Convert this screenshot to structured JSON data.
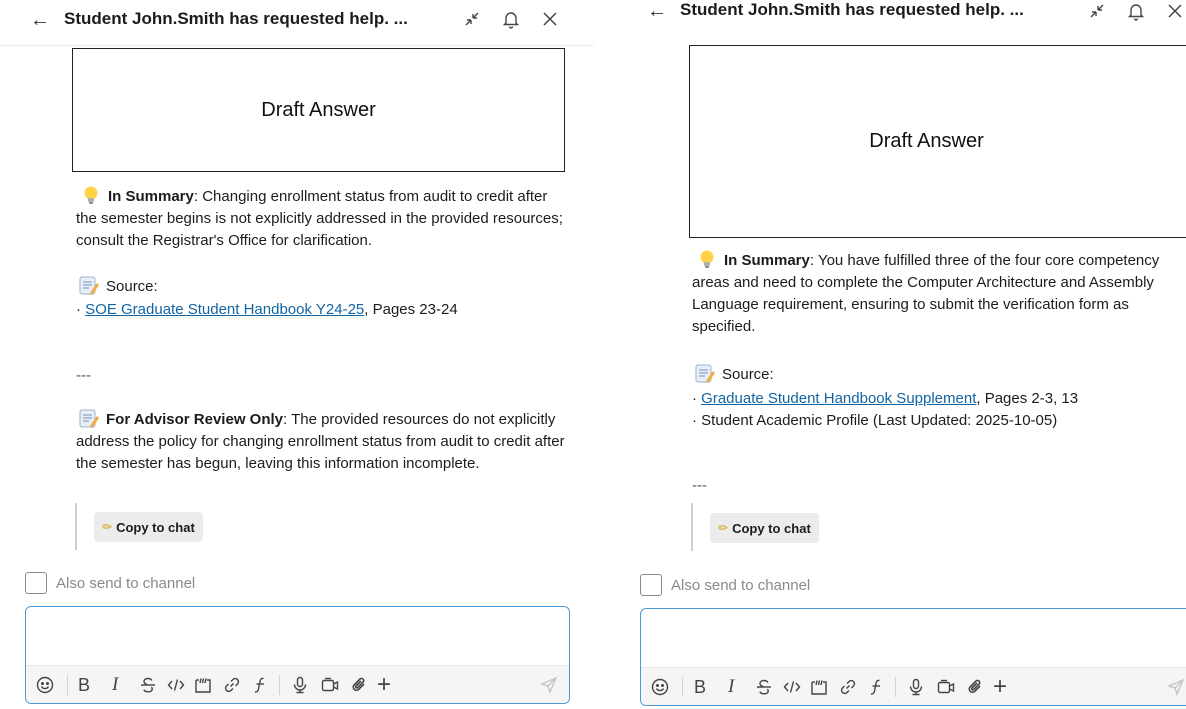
{
  "left_panel": {
    "header": {
      "title": "Student John.Smith has requested help. ..."
    },
    "draft_label": "Draft Answer",
    "summary": {
      "label": "In Summary",
      "text": ": Changing enrollment status from audit to credit after the semester begins is not explicitly addressed in the provided resources; consult the Registrar's Office for clarification."
    },
    "source": {
      "label": "Source:",
      "items": [
        {
          "link": "SOE Graduate Student Handbook Y24-25",
          "text": ", Pages 23-24"
        }
      ]
    },
    "separator": "---",
    "advisor": {
      "label": "For Advisor Review Only",
      "text": ": The provided resources do not explicitly address the policy for changing enrollment status from audit to credit after the semester has begun, leaving this information incomplete."
    },
    "copy_button": "Copy to chat",
    "also_send": "Also send to channel"
  },
  "right_panel": {
    "header": {
      "title": "Student John.Smith has requested help. ..."
    },
    "draft_label": "Draft Answer",
    "summary": {
      "label": "In Summary",
      "text": ": You have fulfilled three of the four core competency areas and need to complete the Computer Architecture and Assembly Language requirement, ensuring to submit the verification form as specified."
    },
    "source": {
      "label": "Source:",
      "items": [
        {
          "link": "Graduate Student Handbook Supplement",
          "text": ", Pages 2-3, 13"
        },
        {
          "link": "",
          "text": "Student Academic Profile (Last Updated: 2025-10-05)"
        }
      ]
    },
    "separator": "---",
    "copy_button": "Copy to chat",
    "also_send": "Also send to channel"
  },
  "toolbar": {
    "icons": [
      "emoji-icon",
      "bold-icon",
      "italic-icon",
      "strikethrough-icon",
      "code-icon",
      "code-block-icon",
      "link-icon",
      "workflow-icon",
      "microphone-icon",
      "video-icon",
      "attachment-icon",
      "plus-icon",
      "send-icon"
    ],
    "glyphs": {
      "bold": "B",
      "italic": "I",
      "plus": "+"
    }
  },
  "colors": {
    "link": "#1264a3",
    "composer_border": "#4a9ad8"
  }
}
